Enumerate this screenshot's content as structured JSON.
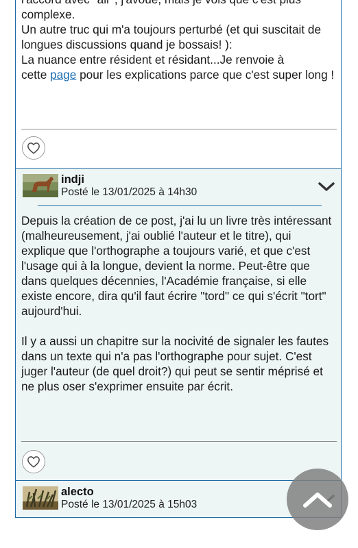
{
  "post_1": {
    "lines": [
      "l'accord avec \"air\", j'avoue, mais je vois que c'est plus complexe.",
      "Un autre truc qui m'a toujours perturbé (et qui suscitait de longues discussions quand je bossais! ):",
      "La nuance entre résident et résidant...Je renvoie à"
    ],
    "link_prefix": "cette ",
    "link_text": "page",
    "link_suffix": " pour les explications parce que c'est super long !"
  },
  "post_2": {
    "author": "indji",
    "date": "Posté le 13/01/2025 à 14h30",
    "paragraph_1": "Depuis la création de ce post, j'ai lu un livre très intéressant (malheureusement, j'ai oublié l'auteur et le titre), qui explique que l'orthographe a toujours varié, et que c'est l'usage qui à la longue, devient la norme. Peut-être que dans quelques décennies, l'Académie française, si elle existe encore, dira qu'il faut écrire \"tord\" ce qui s'écrit \"tort\" aujourd'hui.",
    "paragraph_2": "Il y a aussi un chapitre sur la nocivité de signaler les fautes dans un texte qui n'a pas l'orthographe pour sujet. C'est juger l'auteur (de quel droit?) qui peut se sentir méprisé et ne plus oser s'exprimer ensuite par écrit."
  },
  "post_3": {
    "author": "alecto",
    "date": "Posté le 13/01/2025 à 15h03"
  },
  "icons": {
    "like": "heart-outline-icon",
    "expand": "chevron-down-icon",
    "scroll_top": "chevron-up-icon"
  },
  "colors": {
    "border": "#1f6aa3",
    "post_background": "#eef5f5",
    "link": "#1e6fb5",
    "scroll_button": "#808080"
  }
}
